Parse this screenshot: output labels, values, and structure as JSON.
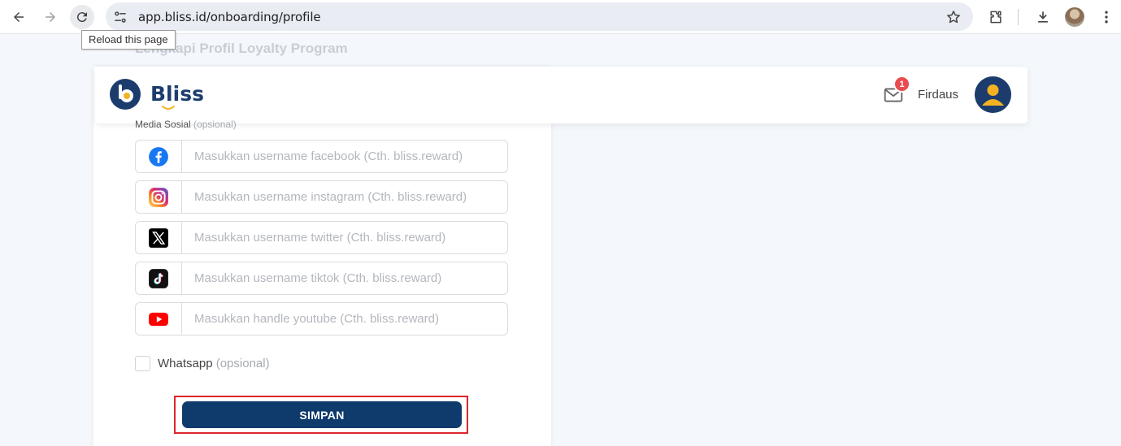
{
  "browser": {
    "url": "app.bliss.id/onboarding/profile",
    "tooltip": "Reload this page"
  },
  "page": {
    "bg_title": "Lengkapi Profil Loyalty Program"
  },
  "header": {
    "brand": "Bliss",
    "notification_count": "1",
    "username": "Firdaus"
  },
  "social": {
    "label": "Media Sosial",
    "label_optional": "(opsional)",
    "fields": [
      {
        "name": "facebook",
        "placeholder": "Masukkan username facebook (Cth. bliss.reward)",
        "value": ""
      },
      {
        "name": "instagram",
        "placeholder": "Masukkan username instagram (Cth. bliss.reward)",
        "value": ""
      },
      {
        "name": "twitter",
        "placeholder": "Masukkan username twitter (Cth. bliss.reward)",
        "value": ""
      },
      {
        "name": "tiktok",
        "placeholder": "Masukkan username tiktok (Cth. bliss.reward)",
        "value": ""
      },
      {
        "name": "youtube",
        "placeholder": "Masukkan handle youtube (Cth. bliss.reward)",
        "value": ""
      }
    ]
  },
  "whatsapp": {
    "label": "Whatsapp",
    "optional": "(opsional)",
    "checked": false
  },
  "actions": {
    "save_label": "SIMPAN"
  },
  "colors": {
    "brand": "#1c3c6d",
    "button": "#0f3a6c",
    "badge": "#e84c4f",
    "highlight": "#e0242b"
  }
}
